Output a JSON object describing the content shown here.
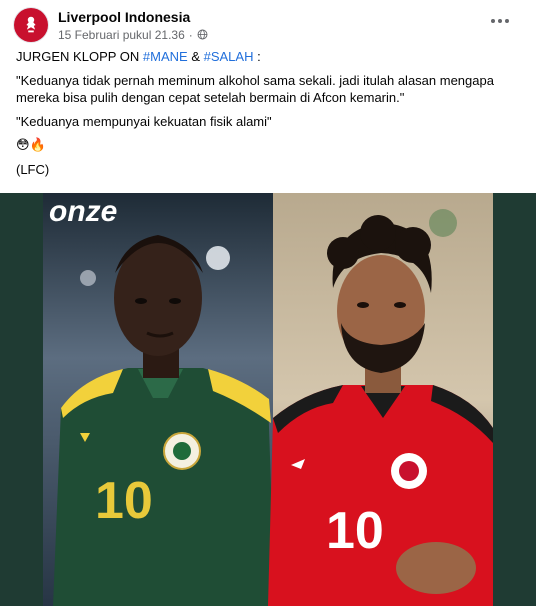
{
  "post": {
    "page_name": "Liverpool Indonesia",
    "timestamp": "15 Februari pukul 21.36",
    "timestamp_separator": "·",
    "privacy_icon": "globe-icon",
    "more_icon": "more-options-icon",
    "line1_prefix": "JURGEN KLOPP ON ",
    "hashtag1": "#MANE",
    "line1_mid": " & ",
    "hashtag2": "#SALAH",
    "line1_suffix": " :",
    "quote1": "\"Keduanya tidak pernah meminum alkohol sama sekali. jadi itulah alasan mengapa mereka bisa pulih dengan cepat setelah bermain di Afcon kemarin.\"",
    "quote2": "\"Keduanya mempunyai kekuatan fisik alami\"",
    "emojis": "😳🔥",
    "signature": "(LFC)"
  },
  "image": {
    "watermark": "onze",
    "left_jersey_number": "10",
    "right_jersey_number": "10"
  },
  "colors": {
    "avatar_bg": "#c8102e",
    "hashtag": "#216fdb",
    "image_bg": "#1f3b33",
    "senegal_green": "#1f4d35",
    "senegal_yellow": "#f2d13b",
    "egypt_red": "#d8111e"
  }
}
